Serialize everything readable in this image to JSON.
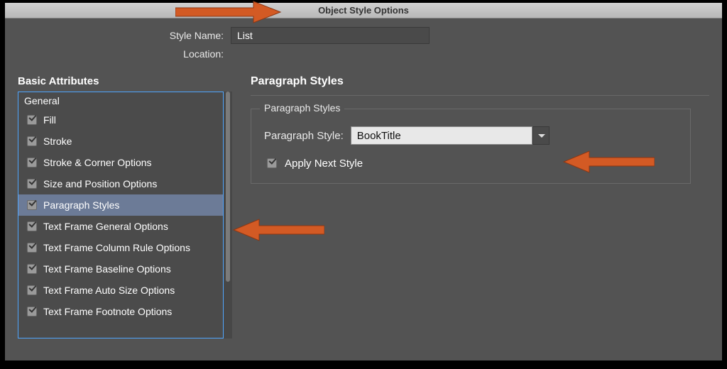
{
  "dialog": {
    "title": "Object Style Options",
    "style_name_label": "Style Name:",
    "style_name_value": "List",
    "location_label": "Location:"
  },
  "sidebar": {
    "header": "Basic Attributes",
    "top_label": "General",
    "items": [
      {
        "label": "Fill",
        "checked": true,
        "selected": false
      },
      {
        "label": "Stroke",
        "checked": true,
        "selected": false
      },
      {
        "label": "Stroke & Corner Options",
        "checked": true,
        "selected": false
      },
      {
        "label": "Size and Position Options",
        "checked": true,
        "selected": false
      },
      {
        "label": "Paragraph Styles",
        "checked": true,
        "selected": true
      },
      {
        "label": "Text Frame General Options",
        "checked": true,
        "selected": false
      },
      {
        "label": "Text Frame Column Rule Options",
        "checked": true,
        "selected": false
      },
      {
        "label": "Text Frame Baseline Options",
        "checked": true,
        "selected": false
      },
      {
        "label": "Text Frame Auto Size Options",
        "checked": true,
        "selected": false
      },
      {
        "label": "Text Frame Footnote Options",
        "checked": true,
        "selected": false
      }
    ]
  },
  "main": {
    "header": "Paragraph Styles",
    "fieldset_title": "Paragraph Styles",
    "paragraph_style_label": "Paragraph Style:",
    "paragraph_style_value": "BookTitle",
    "apply_next_label": "Apply Next Style",
    "apply_next_checked": true
  },
  "colors": {
    "arrow": "#d35a24"
  }
}
